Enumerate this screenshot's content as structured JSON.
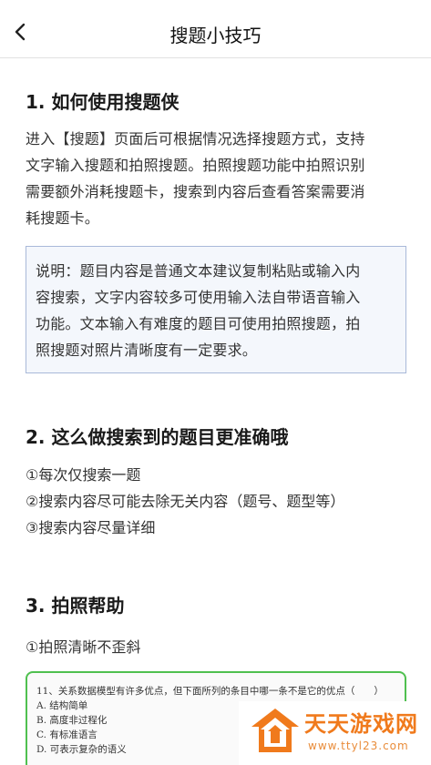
{
  "header": {
    "title": "搜题小技巧"
  },
  "sections": [
    {
      "heading": "1. 如何使用搜题侠",
      "paragraph_lines": [
        "进入【搜题】页面后可根据情况选择搜题方式，支持",
        "文字输入搜题和拍照搜题。拍照搜题功能中拍照识别",
        "需要额外消耗搜题卡，搜索到内容后查看答案需要消",
        "耗搜题卡。"
      ],
      "note_lines": [
        "说明：题目内容是普通文本建议复制粘贴或输入内",
        "容搜索，文字内容较多可使用输入法自带语音输入",
        "功能。文本输入有难度的题目可使用拍照搜题，拍",
        "照搜题对照片清晰度有一定要求。"
      ]
    },
    {
      "heading": "2. 这么做搜索到的题目更准确哦",
      "items": [
        "①每次仅搜索一题",
        "②搜索内容尽可能去除无关内容（题号、题型等）",
        "③搜索内容尽量详细"
      ]
    },
    {
      "heading": "3. 拍照帮助",
      "items": [
        "①拍照清晰不歪斜"
      ]
    }
  ],
  "example": {
    "question": "11、关系数据模型有许多优点，但下面所列的条目中哪一条不是它的优点（　　）",
    "options": [
      "A. 结构简单",
      "B. 高度非过程化",
      "C. 有标准语言",
      "D. 可表示复杂的语义"
    ]
  },
  "watermark": {
    "title": "天天游戏网",
    "url": "www.ttyl23.com"
  },
  "colors": {
    "accent_green": "#4fc04f",
    "note_border": "#a9b9d9",
    "watermark_orange": "#f07a1c"
  },
  "icons": {
    "back": "chevron-left-icon",
    "watermark_logo": "house-logo-icon"
  }
}
